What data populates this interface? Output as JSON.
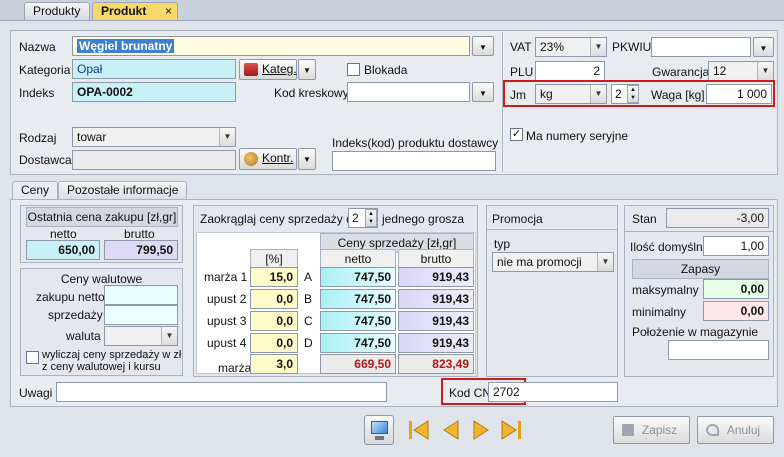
{
  "tabs": [
    "Produkty",
    "Produkt"
  ],
  "tab_close": "×",
  "labels": {
    "nazwa": "Nazwa",
    "kategoria": "Kategoria",
    "indeks": "Indeks",
    "kod_kreskowy": "Kod kreskowy",
    "blokada": "Blokada",
    "rodzaj": "Rodzaj",
    "dostawca": "Dostawca",
    "indeks_dostawcy": "Indeks(kod) produktu dostawcy",
    "vat": "VAT",
    "pkwiu": "PKWIU",
    "plu": "PLU",
    "gwarancja": "Gwarancja",
    "jm": "Jm",
    "waga": "Waga [kg]",
    "ma_numery": "Ma numery seryjne",
    "uwagi": "Uwagi",
    "kod_cn": "Kod CN"
  },
  "fields": {
    "nazwa": "Węgiel brunatny",
    "kategoria": "Opał",
    "kategoria_btn": "Kateg.",
    "indeks": "OPA-0002",
    "kod_kreskowy": "",
    "rodzaj": "towar",
    "dostawca": "",
    "dostawca_btn": "Kontr.",
    "indeks_dostawcy": "",
    "vat": "23%",
    "pkwiu": "",
    "plu": "2",
    "gwarancja": "12",
    "jm": "kg",
    "jm_precision": "2",
    "waga": "1 000",
    "uwagi": "",
    "kod_cn": "2702",
    "ma_numery_checked": "✓"
  },
  "subtabs": [
    "Ceny",
    "Pozostałe informacje"
  ],
  "last_price": {
    "title": "Ostatnia cena zakupu [zł,gr]",
    "netto_label": "netto",
    "brutto_label": "brutto",
    "netto": "650,00",
    "brutto": "799,50"
  },
  "currency": {
    "title": "Ceny walutowe",
    "zakupu_label": "zakupu netto",
    "sprzedazy_label": "sprzedaży",
    "waluta_label": "waluta",
    "wyliczaj_label1": "wyliczaj ceny sprzedaży w zł",
    "wyliczaj_label2": "z ceny walutowej i kursu"
  },
  "rounding": {
    "prefix": "Zaokrąglaj ceny sprzedaży do",
    "value": "2",
    "suffix": "jednego grosza"
  },
  "prices": {
    "pct_header": "[%]",
    "sales_header": "Ceny sprzedaży  [zł,gr]",
    "netto_header": "netto",
    "brutto_header": "brutto",
    "rows": [
      {
        "label": "marża 1",
        "pct": "15,0",
        "letter": "A",
        "netto": "747,50",
        "brutto": "919,43"
      },
      {
        "label": "upust 2",
        "pct": "0,0",
        "letter": "B",
        "netto": "747,50",
        "brutto": "919,43"
      },
      {
        "label": "upust 3",
        "pct": "0,0",
        "letter": "C",
        "netto": "747,50",
        "brutto": "919,43"
      },
      {
        "label": "upust 4",
        "pct": "0,0",
        "letter": "D",
        "netto": "747,50",
        "brutto": "919,43"
      }
    ],
    "marza_label": "marża",
    "marza_pct": "3,0",
    "marza_netto": "669,50",
    "marza_brutto": "823,49"
  },
  "promo": {
    "title": "Promocja",
    "typ_label": "typ",
    "typ_value": "nie ma promocji"
  },
  "stock": {
    "stan_label": "Stan",
    "stan": "-3,00",
    "ilosc_label": "Ilość domyślna",
    "ilosc": "1,00",
    "zapasy_label": "Zapasy",
    "max_label": "maksymalny",
    "max": "0,00",
    "min_label": "minimalny",
    "min": "0,00",
    "polozenie_label": "Położenie w magazynie",
    "polozenie": ""
  },
  "bottom": {
    "zapisz": "Zapisz",
    "anuluj": "Anuluj"
  },
  "colors": {
    "accent_red": "#d21a1a",
    "active_tab": "#f6d86b"
  }
}
